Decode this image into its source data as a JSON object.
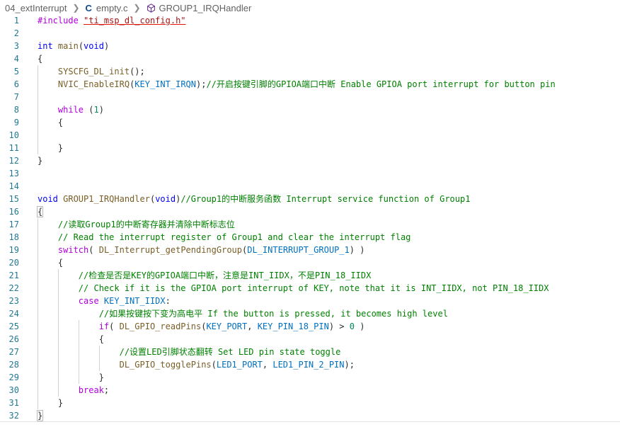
{
  "breadcrumb": {
    "folder": "04_extInterrupt",
    "file": "empty.c",
    "symbol": "GROUP1_IRQHandler",
    "file_icon": "c-file-icon",
    "symbol_icon": "cube-icon"
  },
  "colors": {
    "line_number": "#237893",
    "keyword": "#af00db",
    "type": "#0000ff",
    "function": "#795e26",
    "macro": "#0070c1",
    "comment": "#008000",
    "string": "#a31515"
  },
  "lines": [
    {
      "n": "1",
      "tokens": [
        [
          "pp",
          "#include "
        ],
        [
          "str",
          "\"ti_msp_dl_config.h\""
        ]
      ]
    },
    {
      "n": "2",
      "tokens": []
    },
    {
      "n": "3",
      "tokens": [
        [
          "type",
          "int "
        ],
        [
          "fn",
          "main"
        ],
        [
          "",
          "("
        ],
        [
          "type",
          "void"
        ],
        [
          "",
          ")"
        ]
      ]
    },
    {
      "n": "4",
      "tokens": [
        [
          "",
          "{"
        ]
      ]
    },
    {
      "n": "5",
      "tokens": [
        [
          "",
          "    "
        ],
        [
          "fn",
          "SYSCFG_DL_init"
        ],
        [
          "",
          "();"
        ]
      ]
    },
    {
      "n": "6",
      "tokens": [
        [
          "",
          "    "
        ],
        [
          "fn",
          "NVIC_EnableIRQ"
        ],
        [
          "",
          "("
        ],
        [
          "macro",
          "KEY_INT_IRQN"
        ],
        [
          "",
          ");"
        ],
        [
          "com",
          "//开启按键引脚的GPIOA端口中断 Enable GPIOA port interrupt for button pin"
        ]
      ]
    },
    {
      "n": "7",
      "tokens": []
    },
    {
      "n": "8",
      "tokens": [
        [
          "",
          "    "
        ],
        [
          "kw",
          "while "
        ],
        [
          "",
          "("
        ],
        [
          "num",
          "1"
        ],
        [
          "",
          ")"
        ]
      ]
    },
    {
      "n": "9",
      "tokens": [
        [
          "",
          "    {"
        ]
      ]
    },
    {
      "n": "10",
      "tokens": []
    },
    {
      "n": "11",
      "tokens": [
        [
          "",
          "    }"
        ]
      ]
    },
    {
      "n": "12",
      "tokens": [
        [
          "",
          "}"
        ]
      ]
    },
    {
      "n": "13",
      "tokens": []
    },
    {
      "n": "14",
      "tokens": []
    },
    {
      "n": "15",
      "tokens": [
        [
          "type",
          "void "
        ],
        [
          "fn",
          "GROUP1_IRQHandler"
        ],
        [
          "",
          "("
        ],
        [
          "type",
          "void"
        ],
        [
          "",
          ")"
        ],
        [
          "com",
          "//Group1的中断服务函数 Interrupt service function of Group1"
        ]
      ]
    },
    {
      "n": "16",
      "tokens": [
        [
          "hl",
          "{"
        ]
      ]
    },
    {
      "n": "17",
      "tokens": [
        [
          "",
          "    "
        ],
        [
          "com",
          "//读取Group1的中断寄存器并清除中断标志位"
        ]
      ]
    },
    {
      "n": "18",
      "tokens": [
        [
          "",
          "    "
        ],
        [
          "com",
          "// Read the interrupt register of Group1 and clear the interrupt flag"
        ]
      ]
    },
    {
      "n": "19",
      "tokens": [
        [
          "",
          "    "
        ],
        [
          "kw",
          "switch"
        ],
        [
          "",
          "( "
        ],
        [
          "fn",
          "DL_Interrupt_getPendingGroup"
        ],
        [
          "",
          "("
        ],
        [
          "macro",
          "DL_INTERRUPT_GROUP_1"
        ],
        [
          "",
          ") )"
        ]
      ]
    },
    {
      "n": "20",
      "tokens": [
        [
          "",
          "    {"
        ]
      ]
    },
    {
      "n": "21",
      "tokens": [
        [
          "",
          "        "
        ],
        [
          "com",
          "//检查是否是KEY的GPIOA端口中断，注意是INT_IIDX，不是PIN_18_IIDX"
        ]
      ]
    },
    {
      "n": "22",
      "tokens": [
        [
          "",
          "        "
        ],
        [
          "com",
          "// Check if it is the GPIOA port interrupt of KEY, note that it is INT_IIDX, not PIN_18_IIDX"
        ]
      ]
    },
    {
      "n": "23",
      "tokens": [
        [
          "",
          "        "
        ],
        [
          "kw",
          "case "
        ],
        [
          "macro",
          "KEY_INT_IIDX"
        ],
        [
          "",
          ":"
        ]
      ]
    },
    {
      "n": "24",
      "tokens": [
        [
          "",
          "            "
        ],
        [
          "com",
          "//如果按键按下变为高电平 If the button is pressed, it becomes high level"
        ]
      ]
    },
    {
      "n": "25",
      "tokens": [
        [
          "",
          "            "
        ],
        [
          "kw",
          "if"
        ],
        [
          "",
          "( "
        ],
        [
          "fn",
          "DL_GPIO_readPins"
        ],
        [
          "",
          "("
        ],
        [
          "macro",
          "KEY_PORT"
        ],
        [
          "",
          ", "
        ],
        [
          "macro",
          "KEY_PIN_18_PIN"
        ],
        [
          "",
          ") > "
        ],
        [
          "num",
          "0"
        ],
        [
          "",
          " )"
        ]
      ]
    },
    {
      "n": "26",
      "tokens": [
        [
          "",
          "            {"
        ]
      ]
    },
    {
      "n": "27",
      "tokens": [
        [
          "",
          "                "
        ],
        [
          "com",
          "//设置LED引脚状态翻转 Set LED pin state toggle"
        ]
      ]
    },
    {
      "n": "28",
      "tokens": [
        [
          "",
          "                "
        ],
        [
          "fn",
          "DL_GPIO_togglePins"
        ],
        [
          "",
          "("
        ],
        [
          "macro",
          "LED1_PORT"
        ],
        [
          "",
          ", "
        ],
        [
          "macro",
          "LED1_PIN_2_PIN"
        ],
        [
          "",
          ");"
        ]
      ]
    },
    {
      "n": "29",
      "tokens": [
        [
          "",
          "            }"
        ]
      ]
    },
    {
      "n": "30",
      "tokens": [
        [
          "",
          "        "
        ],
        [
          "kw",
          "break"
        ],
        [
          "",
          ";"
        ]
      ]
    },
    {
      "n": "31",
      "tokens": [
        [
          "",
          "    }"
        ]
      ]
    },
    {
      "n": "32",
      "tokens": [
        [
          "hl",
          "}"
        ]
      ]
    }
  ]
}
